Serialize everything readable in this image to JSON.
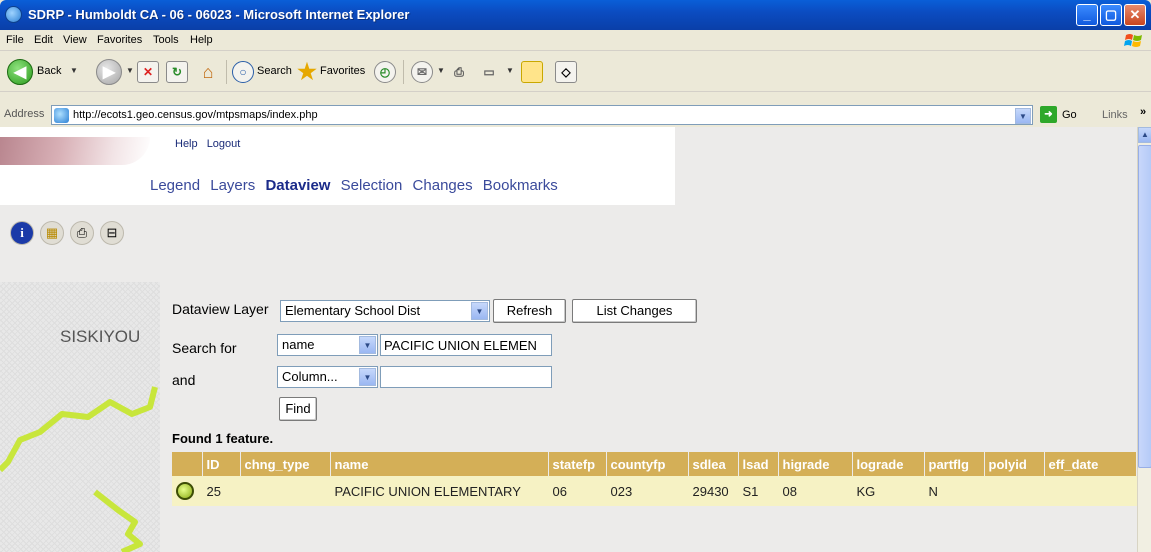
{
  "window": {
    "title": "SDRP - Humboldt CA - 06 - 06023 - Microsoft Internet Explorer"
  },
  "menu": [
    "File",
    "Edit",
    "View",
    "Favorites",
    "Tools",
    "Help"
  ],
  "toolbar": {
    "back_label": "Back",
    "search_label": "Search",
    "favorites_label": "Favorites"
  },
  "address": {
    "label": "Address",
    "url": "http://ecots1.geo.census.gov/mtpsmaps/index.php",
    "go_label": "Go",
    "links_label": "Links"
  },
  "header_links": [
    "Help",
    "Logout"
  ],
  "tabs": [
    "Legend",
    "Layers",
    "Dataview",
    "Selection",
    "Changes",
    "Bookmarks"
  ],
  "active_tab": "Dataview",
  "map": {
    "label": "SISKIYOU"
  },
  "form": {
    "dataview_layer_label": "Dataview Layer",
    "dataview_layer_value": "Elementary School Dist",
    "refresh_label": "Refresh",
    "list_changes_label": "List Changes",
    "search_for_label": "Search for",
    "search_column_value": "name",
    "search_value": "PACIFIC UNION ELEMEN",
    "and_label": "and",
    "and_column_value": "Column...",
    "and_value": "",
    "find_label": "Find"
  },
  "results": {
    "found_text": "Found 1 feature.",
    "columns": [
      "",
      "ID",
      "chng_type",
      "name",
      "statefp",
      "countyfp",
      "sdlea",
      "lsad",
      "higrade",
      "lograde",
      "partflg",
      "polyid",
      "eff_date"
    ],
    "rows": [
      [
        "",
        "25",
        "",
        "PACIFIC UNION ELEMENTARY",
        "06",
        "023",
        "29430",
        "S1",
        "08",
        "KG",
        "N",
        "",
        ""
      ]
    ]
  }
}
